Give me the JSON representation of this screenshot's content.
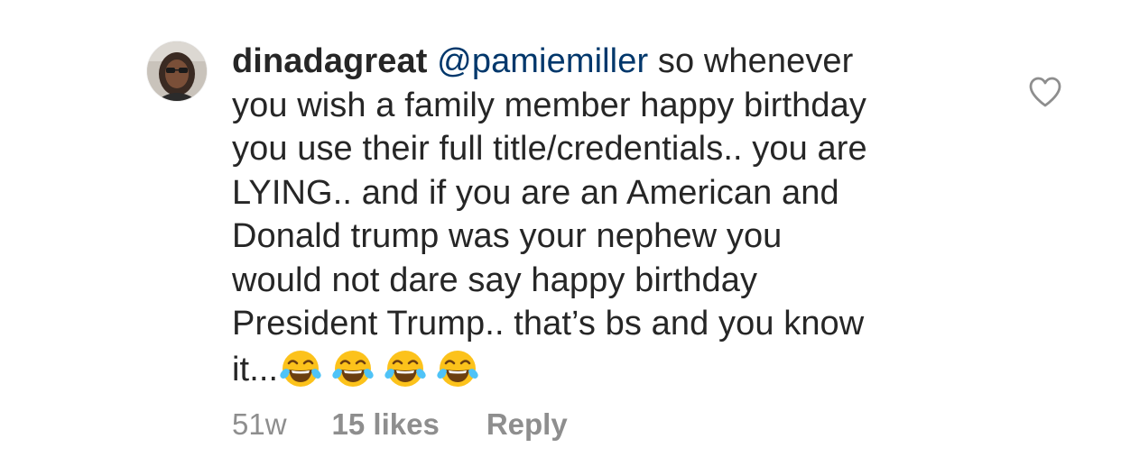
{
  "comment": {
    "username": "dinadagreat",
    "mention": "@pamiemiller",
    "lines": [
      " so whenever",
      "you wish a family member happy birthday",
      "you use their full title/credentials.. you are",
      "LYING.. and if you are an American and",
      "Donald trump was your nephew you",
      "would not dare say happy birthday",
      "President Trump.. that’s bs and you know",
      "it..."
    ],
    "emojis": [
      "face-with-tears-of-joy",
      "face-with-tears-of-joy",
      "face-with-tears-of-joy",
      "face-with-tears-of-joy"
    ],
    "like_icon": "heart-outline-icon"
  },
  "meta": {
    "time": "51w",
    "likes": "15 likes",
    "reply": "Reply"
  },
  "colors": {
    "text": "#262626",
    "mention": "#00376b",
    "secondary": "#8e8e8e"
  }
}
